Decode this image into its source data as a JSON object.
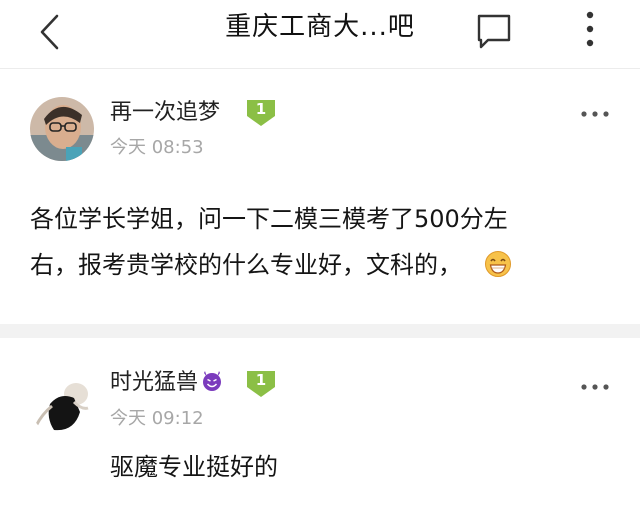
{
  "header": {
    "title": "重庆工商大...吧"
  },
  "posts": [
    {
      "username": "再一次追梦",
      "level": "1",
      "time": "今天 08:53",
      "content_line1": "各位学长学姐，问一下二模三模考了500分左",
      "content_line2": "右，报考贵学校的什么专业好，文科的，",
      "emoji": "grinning-face"
    },
    {
      "username": "时光猛兽",
      "username_emoji": "smiling-devil",
      "level": "1",
      "time": "今天 09:12",
      "content": "驱魔专业挺好的"
    }
  ],
  "colors": {
    "level_badge": "#8bbf46",
    "time_text": "#a7a7a7",
    "divider": "#f2f2f2",
    "devil": "#7b3bbd"
  }
}
